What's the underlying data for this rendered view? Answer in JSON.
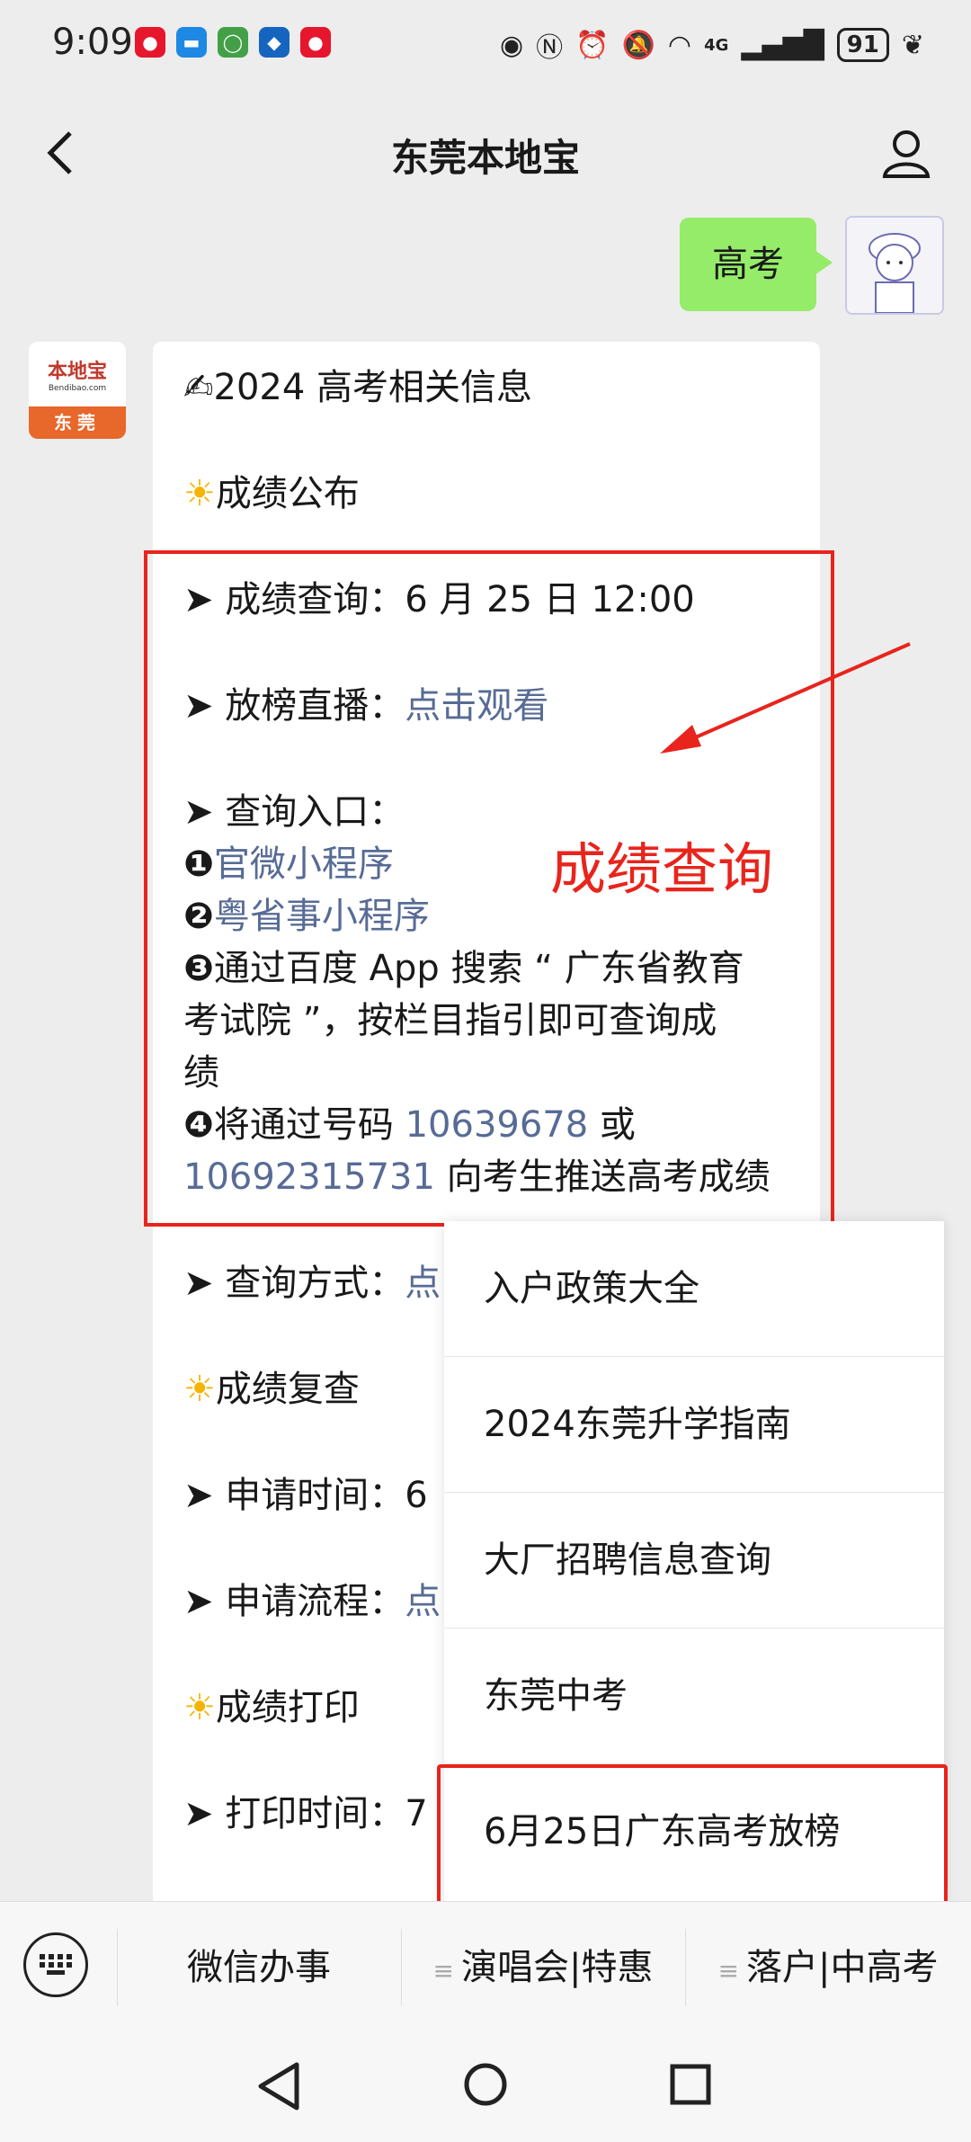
{
  "status_bar": {
    "time": "9:09",
    "battery": "91",
    "network": "4G"
  },
  "header": {
    "title": "东莞本地宝"
  },
  "user_message": {
    "text": "高考"
  },
  "bot": {
    "avatar_brand": "本地宝",
    "avatar_url": "Bendibao.com",
    "avatar_city": "东莞"
  },
  "message": {
    "heading_icon": "✍",
    "heading": "2024 高考相关信息",
    "sections": {
      "results_icon": "☀",
      "results": "成绩公布",
      "query_time_label": "➤ 成绩查询：",
      "query_time_value": "6 月 25 日 12:00",
      "live_label": "➤ 放榜直播：",
      "live_link": "点击观看",
      "entry_label": "➤ 查询入口：",
      "entry1_num": "❶",
      "entry1": "官微小程序",
      "entry2_num": "❷",
      "entry2": "粤省事小程序",
      "entry3_num": "❸",
      "entry3_line1": "通过百度 App 搜索 “ 广东省教育",
      "entry3_line2": "考试院 ”，按栏目指引即可查询成",
      "entry3_line3": "绩",
      "entry4_num": "❹",
      "entry4_pre": "将通过号码 ",
      "entry4_num1": "10639678",
      "entry4_mid": " 或",
      "entry4_num2": "10692315731",
      "entry4_post": " 向考生推送高考成绩",
      "method_label": "➤ 查询方式：",
      "method_link": "点",
      "review_icon": "☀",
      "review": "成绩复查",
      "apply_time_label": "➤ 申请时间：",
      "apply_time_value": "6",
      "apply_flow_label": "➤ 申请流程：",
      "apply_flow_link": "点",
      "print_icon": "☀",
      "print": "成绩打印",
      "print_time_label": "➤ 打印时间：",
      "print_time_value": "7"
    }
  },
  "annotation": {
    "text": "成绩查询",
    "color": "#e8241c"
  },
  "popup_menu": {
    "items": [
      {
        "label": "入户政策大全"
      },
      {
        "label": "2024东莞升学指南"
      },
      {
        "label": "大厂招聘信息查询"
      },
      {
        "label": "东莞中考"
      },
      {
        "label": "6月25日广东高考放榜"
      }
    ]
  },
  "bottom_bar": {
    "tab1": "微信办事",
    "tab2": "演唱会|特惠",
    "tab3": "落户|中高考",
    "menu_glyph": "≡"
  },
  "colors": {
    "link": "#576b95",
    "user_bubble": "#95ec69",
    "highlight": "#e8241c",
    "background": "#ededed"
  }
}
